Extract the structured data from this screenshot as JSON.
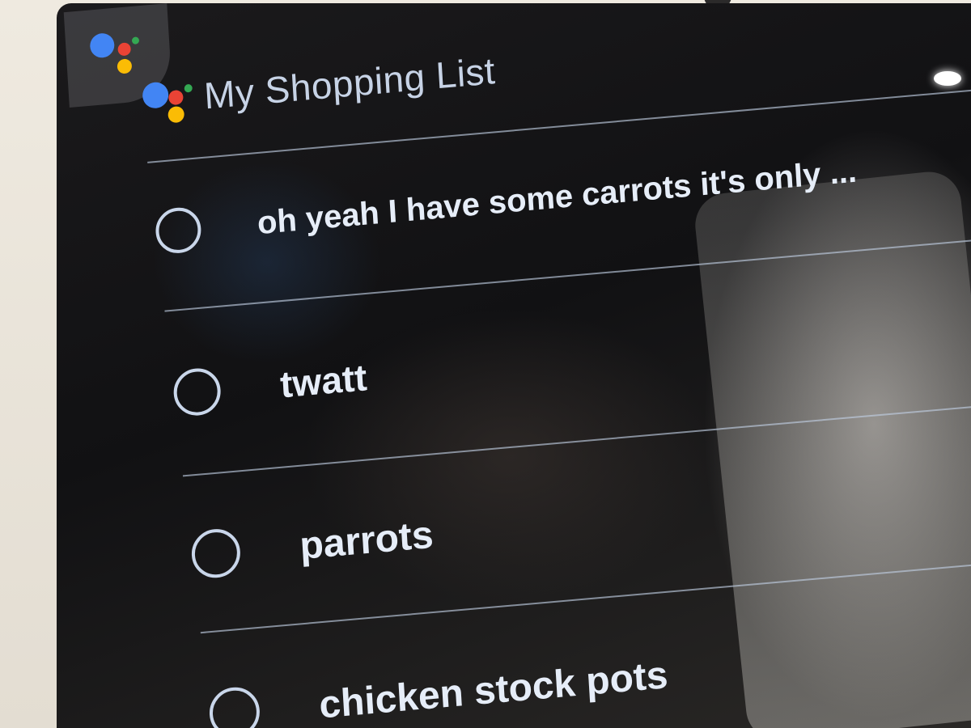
{
  "app": {
    "title": "My Shopping List",
    "accent_colors": {
      "blue": "#4285F4",
      "red": "#EA4335",
      "yellow": "#FBBC05",
      "green": "#34A853"
    },
    "logo_icon": "google-assistant-icon",
    "checkbox_icon": "circle-outline-icon"
  },
  "list": {
    "items": [
      {
        "label": "oh yeah I have some carrots it's only ...",
        "checked": false
      },
      {
        "label": "twatt",
        "checked": false
      },
      {
        "label": "parrots",
        "checked": false
      },
      {
        "label": "chicken stock pots",
        "checked": false
      }
    ]
  }
}
